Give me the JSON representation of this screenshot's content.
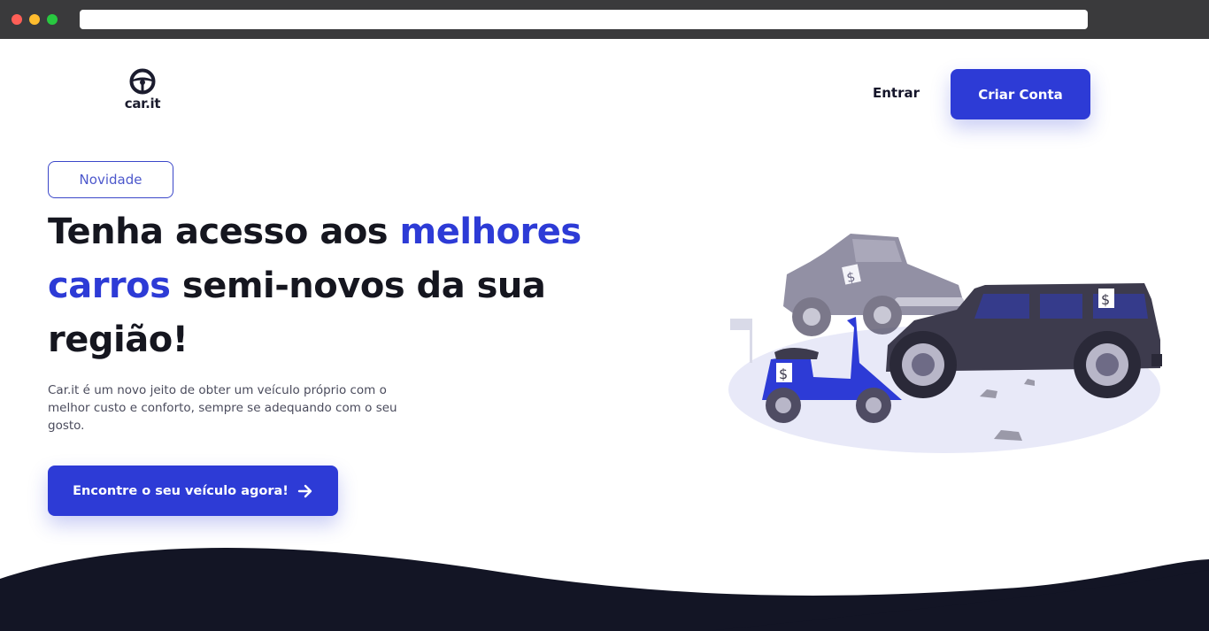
{
  "browser": {
    "url": ""
  },
  "header": {
    "logo_text": "car.it",
    "login_label": "Entrar",
    "signup_label": "Criar Conta"
  },
  "hero": {
    "badge": "Novidade",
    "headline_part1": "Tenha acesso aos ",
    "headline_accent1": "melhores",
    "headline_accent2": "carros",
    "headline_part2": " semi-novos da sua região!",
    "description": "Car.it é um novo jeito de obter um veículo próprio com o melhor custo e conforto, sempre se adequando com o seu gosto.",
    "cta_label": "Encontre o seu veículo agora!"
  },
  "illustration": {
    "price_tag_symbol": "$"
  },
  "colors": {
    "primary": "#2d3bd6",
    "dark": "#14152a",
    "footer": "#131525"
  }
}
